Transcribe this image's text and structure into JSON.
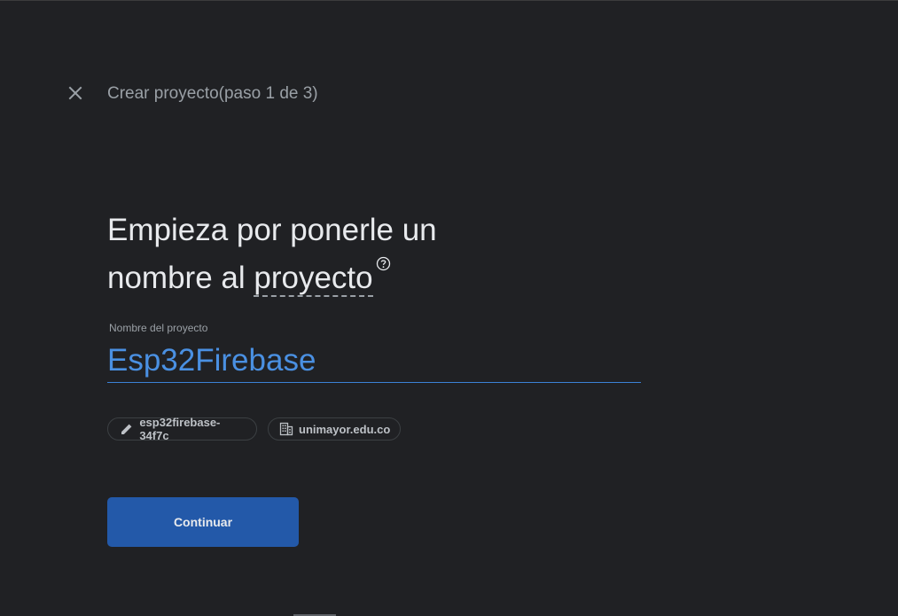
{
  "header": {
    "close_icon": "close-icon",
    "step_title": "Crear proyecto(paso 1 de 3)"
  },
  "main": {
    "heading_part1": "Empieza por ponerle un nombre al ",
    "heading_link": "proyecto",
    "help_icon": "help-circle-icon",
    "field_label": "Nombre del proyecto",
    "project_name_value": "Esp32Firebase",
    "chips": {
      "project_id": {
        "label": "esp32firebase-34f7c",
        "icon": "pencil-icon"
      },
      "organization": {
        "label": "unimayor.edu.co",
        "icon": "building-icon"
      }
    },
    "continue_label": "Continuar"
  },
  "colors": {
    "background": "#202124",
    "accent": "#4a90e2",
    "button": "#2359a9",
    "text_primary": "#e8eaed",
    "text_secondary": "#9aa0a6"
  }
}
